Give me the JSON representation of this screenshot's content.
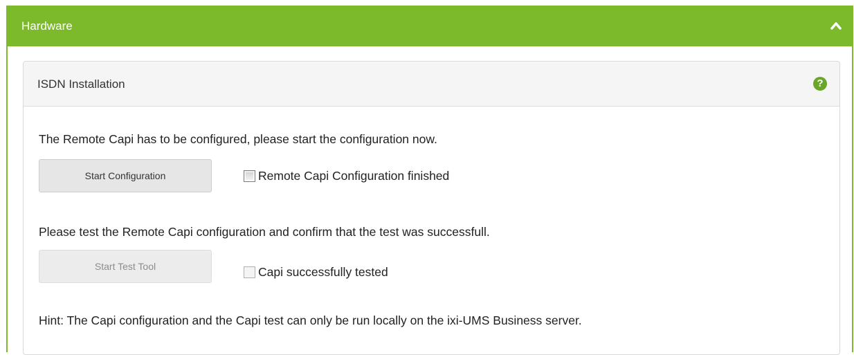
{
  "section": {
    "title": "Hardware",
    "collapse_icon": "chevron-up-icon"
  },
  "panel": {
    "title": "ISDN Installation",
    "help_icon": "question-circle-icon",
    "help_glyph": "?",
    "intro_text": "The Remote Capi has to be configured, please start the configuration now.",
    "start_config_label": "Start Configuration",
    "config_finished_label": "Remote Capi Configuration finished",
    "test_text": "Please test the Remote Capi configuration and confirm that the test was successfull.",
    "start_test_label": "Start Test Tool",
    "test_success_label": "Capi successfully tested",
    "hint_text": "Hint: The Capi configuration and the Capi test can only be run locally on the ixi-UMS Business server."
  },
  "colors": {
    "accent": "#7cba2b",
    "panel_header_bg": "#f5f5f5",
    "button_bg": "#e6e6e6"
  }
}
